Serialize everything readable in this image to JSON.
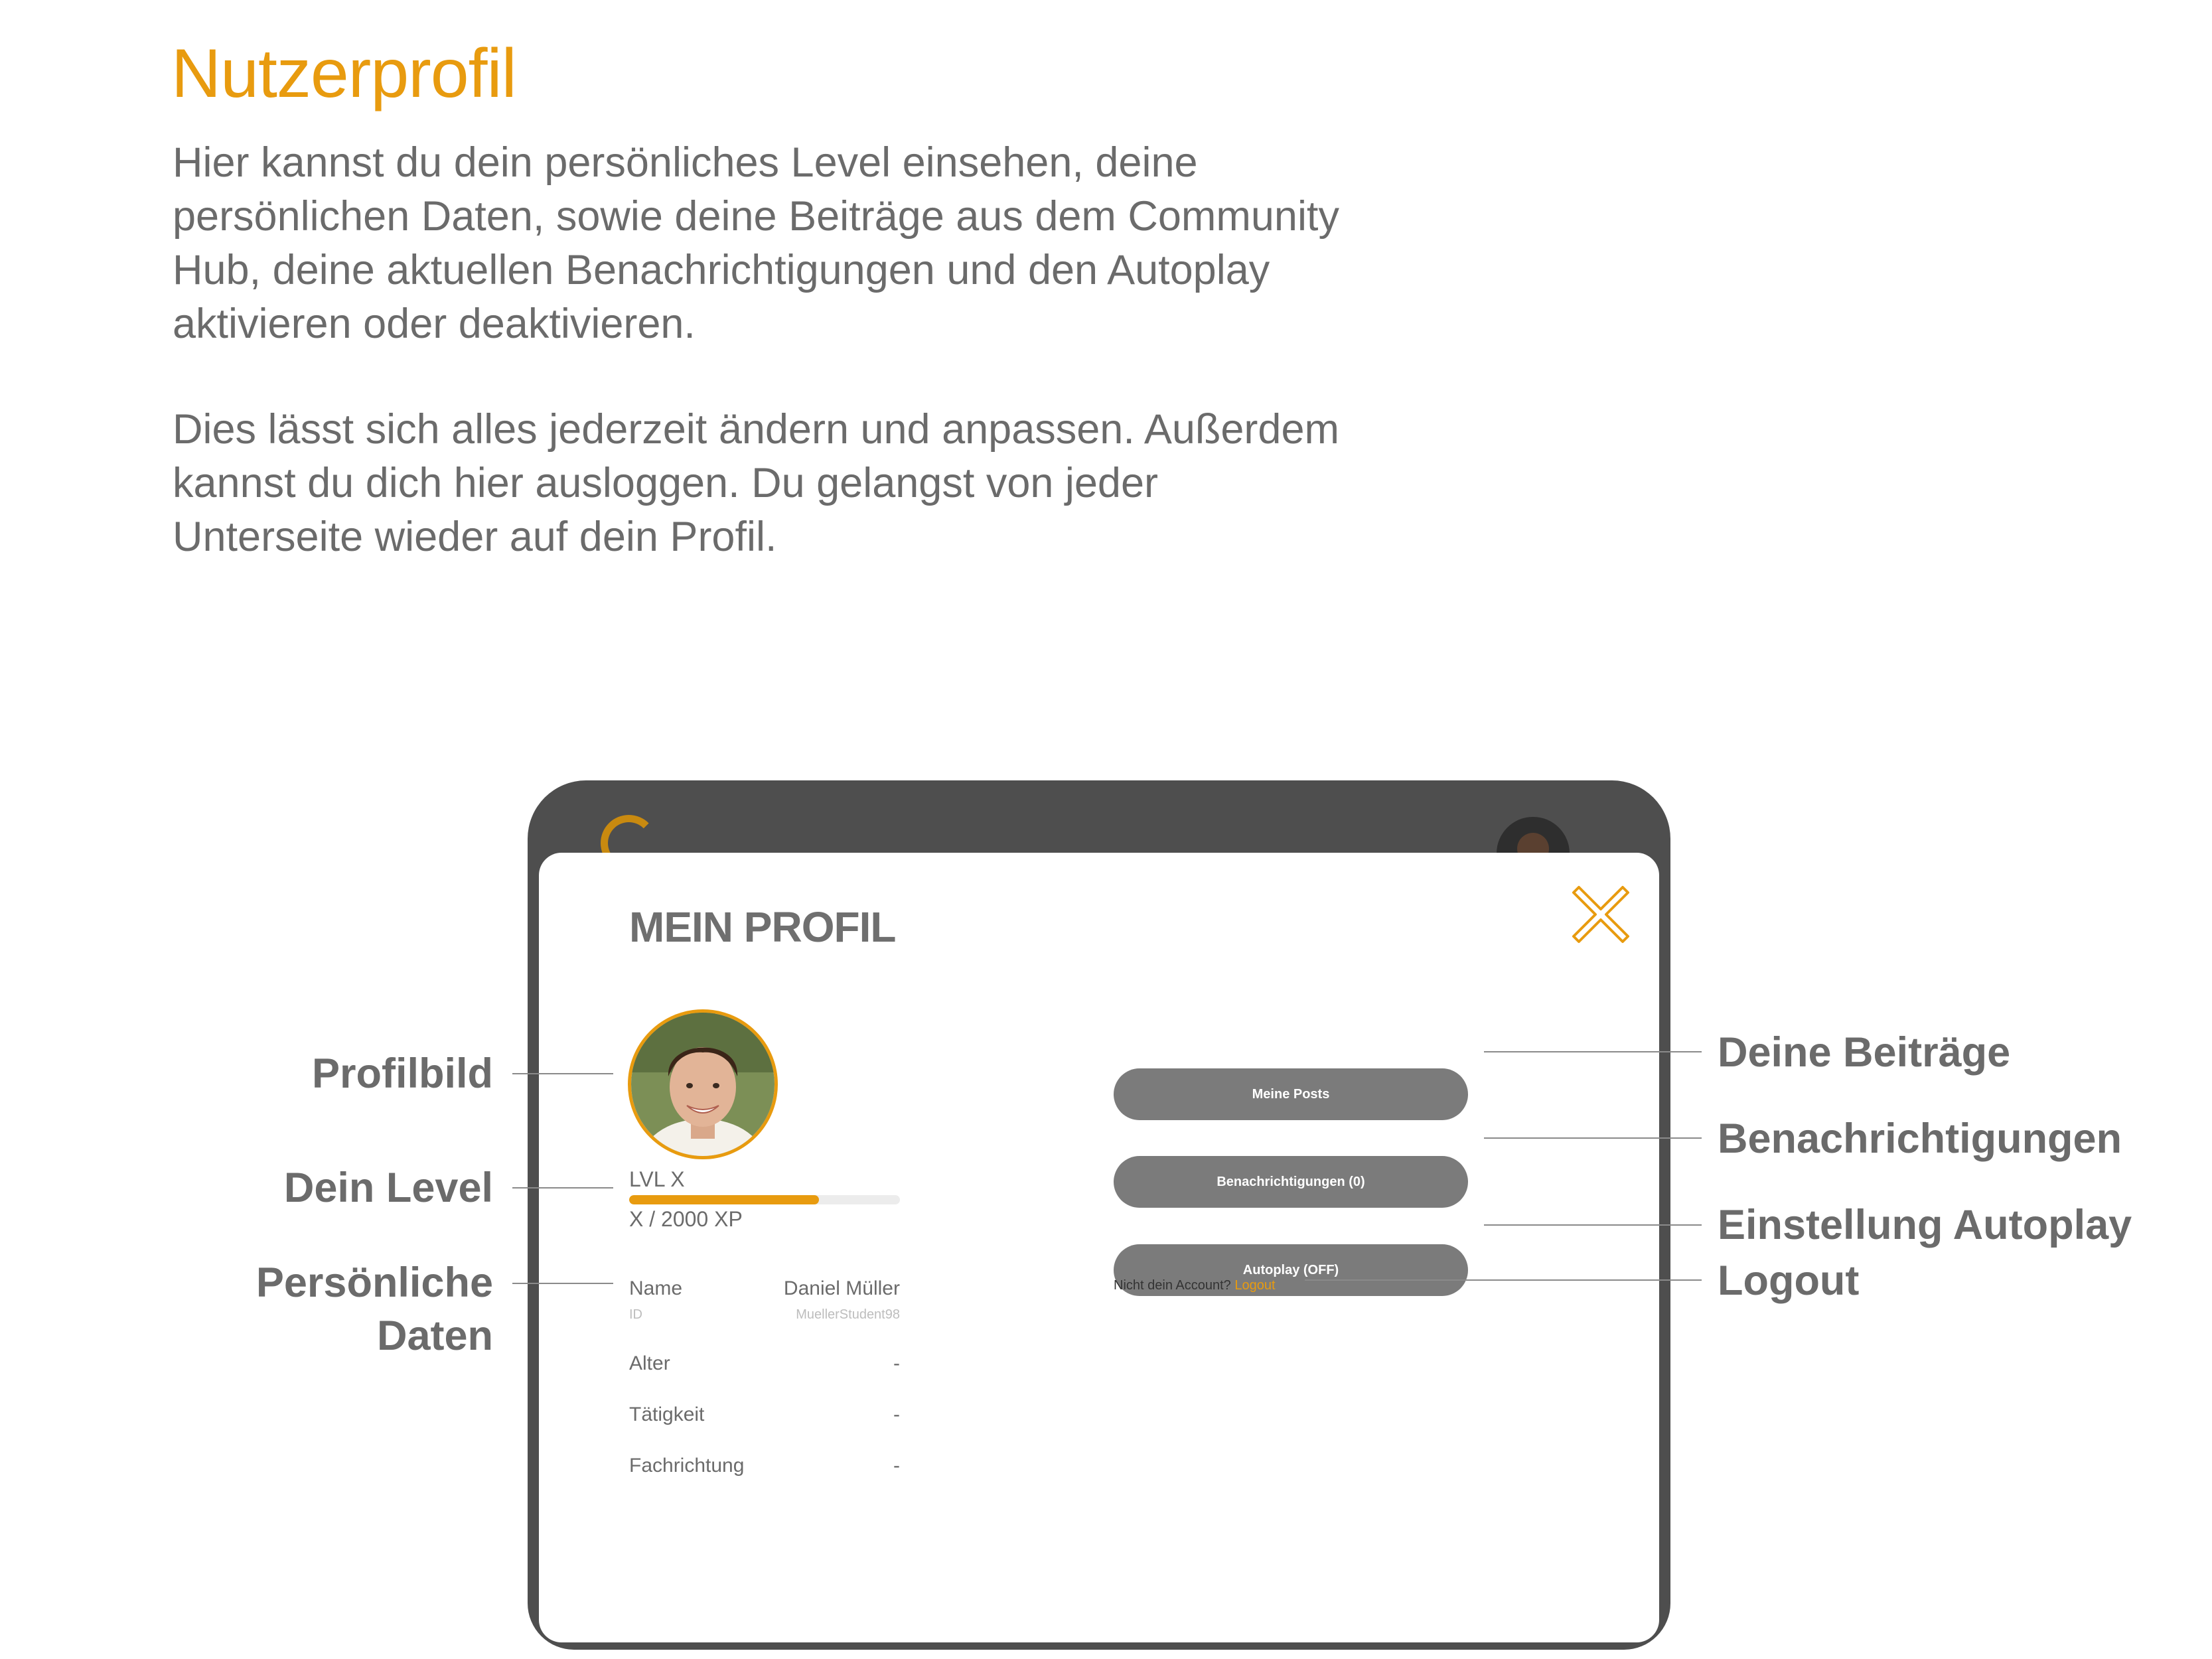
{
  "page": {
    "title": "Nutzerprofil",
    "intro_p1": "Hier kannst du dein persönliches Level einsehen, deine persönlichen Daten, sowie deine Beiträge aus dem Community Hub, deine aktuellen Benachrichtigungen und den Autoplay aktivieren oder deaktivieren.",
    "intro_p2": "Dies lässt sich alles jederzeit ändern und anpassen. Außerdem kannst du dich hier ausloggen. Du gelangst von jeder Unterseite wieder auf dein Profil."
  },
  "modal": {
    "title": "MEIN PROFIL",
    "close_icon": "close-x-icon",
    "level": {
      "label": "LVL X",
      "xp": "X / 2000 XP",
      "progress_fraction": 0.7
    },
    "info": [
      {
        "label": "Name",
        "value": "Daniel Müller"
      },
      {
        "label": "Alter",
        "value": "-"
      },
      {
        "label": "Tätigkeit",
        "value": "-"
      },
      {
        "label": "Fachrichtung",
        "value": "-"
      }
    ],
    "id_row": {
      "label": "ID",
      "value": "MuellerStudent98"
    },
    "buttons": {
      "posts": "Meine Posts",
      "notifications": "Benachrichtigungen (0)",
      "autoplay": "Autoplay (OFF)"
    },
    "account_text": "Nicht dein Account?",
    "logout": "Logout"
  },
  "callouts": {
    "profilbild": "Profilbild",
    "level": "Dein Level",
    "daten_1": "Persönliche",
    "daten_2": "Daten",
    "beitraege": "Deine Beiträge",
    "benachrichtigungen": "Benachrichtigungen",
    "autoplay": "Einstellung Autoplay",
    "logout": "Logout"
  },
  "colors": {
    "accent": "#e89b0f",
    "text": "#6b6b6b",
    "device": "#4e4e4e",
    "button": "#7b7b7b"
  }
}
